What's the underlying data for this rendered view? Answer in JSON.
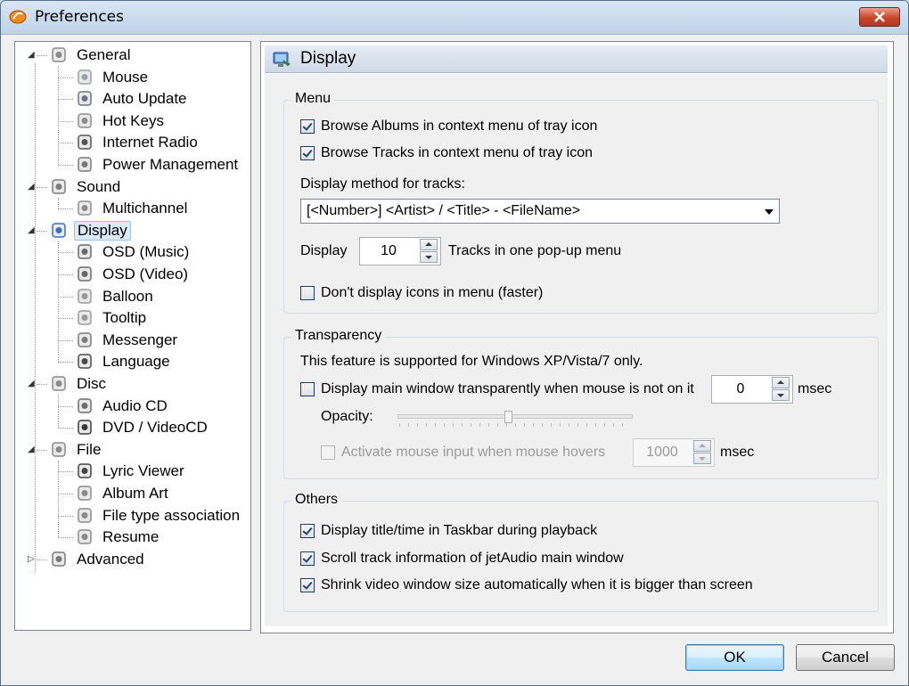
{
  "window": {
    "title": "Preferences"
  },
  "tree": {
    "items": [
      {
        "label": "General",
        "icon": "checklist-icon",
        "level": 0,
        "expander": "expanded"
      },
      {
        "label": "Mouse",
        "icon": "mouse-icon",
        "level": 1
      },
      {
        "label": "Auto Update",
        "icon": "globe-update-icon",
        "level": 1
      },
      {
        "label": "Hot Keys",
        "icon": "keyboard-icon",
        "level": 1
      },
      {
        "label": "Internet Radio",
        "icon": "radio-tower-icon",
        "level": 1
      },
      {
        "label": "Power Management",
        "icon": "power-icon",
        "level": 1
      },
      {
        "label": "Sound",
        "icon": "speaker-icon",
        "level": 0,
        "expander": "expanded"
      },
      {
        "label": "Multichannel",
        "icon": "multichannel-icon",
        "level": 1
      },
      {
        "label": "Display",
        "icon": "monitor-icon",
        "level": 0,
        "expander": "expanded",
        "selected": true
      },
      {
        "label": "OSD (Music)",
        "icon": "osd-music-icon",
        "level": 1
      },
      {
        "label": "OSD (Video)",
        "icon": "osd-video-icon",
        "level": 1
      },
      {
        "label": "Balloon",
        "icon": "balloon-icon",
        "level": 1
      },
      {
        "label": "Tooltip",
        "icon": "tooltip-icon",
        "level": 1
      },
      {
        "label": "Messenger",
        "icon": "messenger-icon",
        "level": 1
      },
      {
        "label": "Language",
        "icon": "globe-icon",
        "level": 1
      },
      {
        "label": "Disc",
        "icon": "disc-drive-icon",
        "level": 0,
        "expander": "expanded"
      },
      {
        "label": "Audio CD",
        "icon": "cd-icon",
        "level": 1
      },
      {
        "label": "DVD / VideoCD",
        "icon": "dvd-icon",
        "level": 1
      },
      {
        "label": "File",
        "icon": "file-icon",
        "level": 0,
        "expander": "expanded"
      },
      {
        "label": "Lyric Viewer",
        "icon": "microphone-icon",
        "level": 1
      },
      {
        "label": "Album Art",
        "icon": "album-art-icon",
        "level": 1
      },
      {
        "label": "File type association",
        "icon": "file-association-icon",
        "level": 1
      },
      {
        "label": "Resume",
        "icon": "resume-icon",
        "level": 1
      },
      {
        "label": "Advanced",
        "icon": "advanced-icon",
        "level": 0,
        "expander": "collapsed"
      }
    ]
  },
  "panel": {
    "title": "Display",
    "menu_group": {
      "title": "Menu",
      "browse_albums": {
        "label": "Browse Albums in context menu of tray icon",
        "checked": true
      },
      "browse_tracks": {
        "label": "Browse Tracks in context menu of tray icon",
        "checked": true
      },
      "display_method_label": "Display method for tracks:",
      "display_method_value": "[<Number>] <Artist> / <Title> - <FileName>",
      "display_prefix": "Display",
      "tracks_count": "10",
      "tracks_suffix": "Tracks in one pop-up menu",
      "dont_display_icons": {
        "label": "Don't display icons in menu (faster)",
        "checked": false
      }
    },
    "transparency_group": {
      "title": "Transparency",
      "note": "This feature is supported for Windows XP/Vista/7 only.",
      "transparent_window": {
        "label": "Display main window transparently when mouse is not on it",
        "checked": false
      },
      "transparent_msec": "0",
      "msec_label": "msec",
      "opacity_label": "Opacity:",
      "opacity_level": 0.47,
      "activate_mouse": {
        "label": "Activate mouse input when mouse hovers",
        "checked": false,
        "enabled": false
      },
      "activate_msec": "1000",
      "msec_label2": "msec"
    },
    "others_group": {
      "title": "Others",
      "title_in_taskbar": {
        "label": "Display title/time in Taskbar during playback",
        "checked": true
      },
      "scroll_track": {
        "label": "Scroll track information of jetAudio main window",
        "checked": true
      },
      "shrink_video": {
        "label": "Shrink video window size automatically when it is bigger than screen",
        "checked": true
      }
    }
  },
  "buttons": {
    "ok": "OK",
    "cancel": "Cancel"
  },
  "colors": {
    "title_bar": "#c8daf0",
    "selection": "#dce9f8",
    "close_button": "#c9452b",
    "check_mark": "#20457f"
  }
}
